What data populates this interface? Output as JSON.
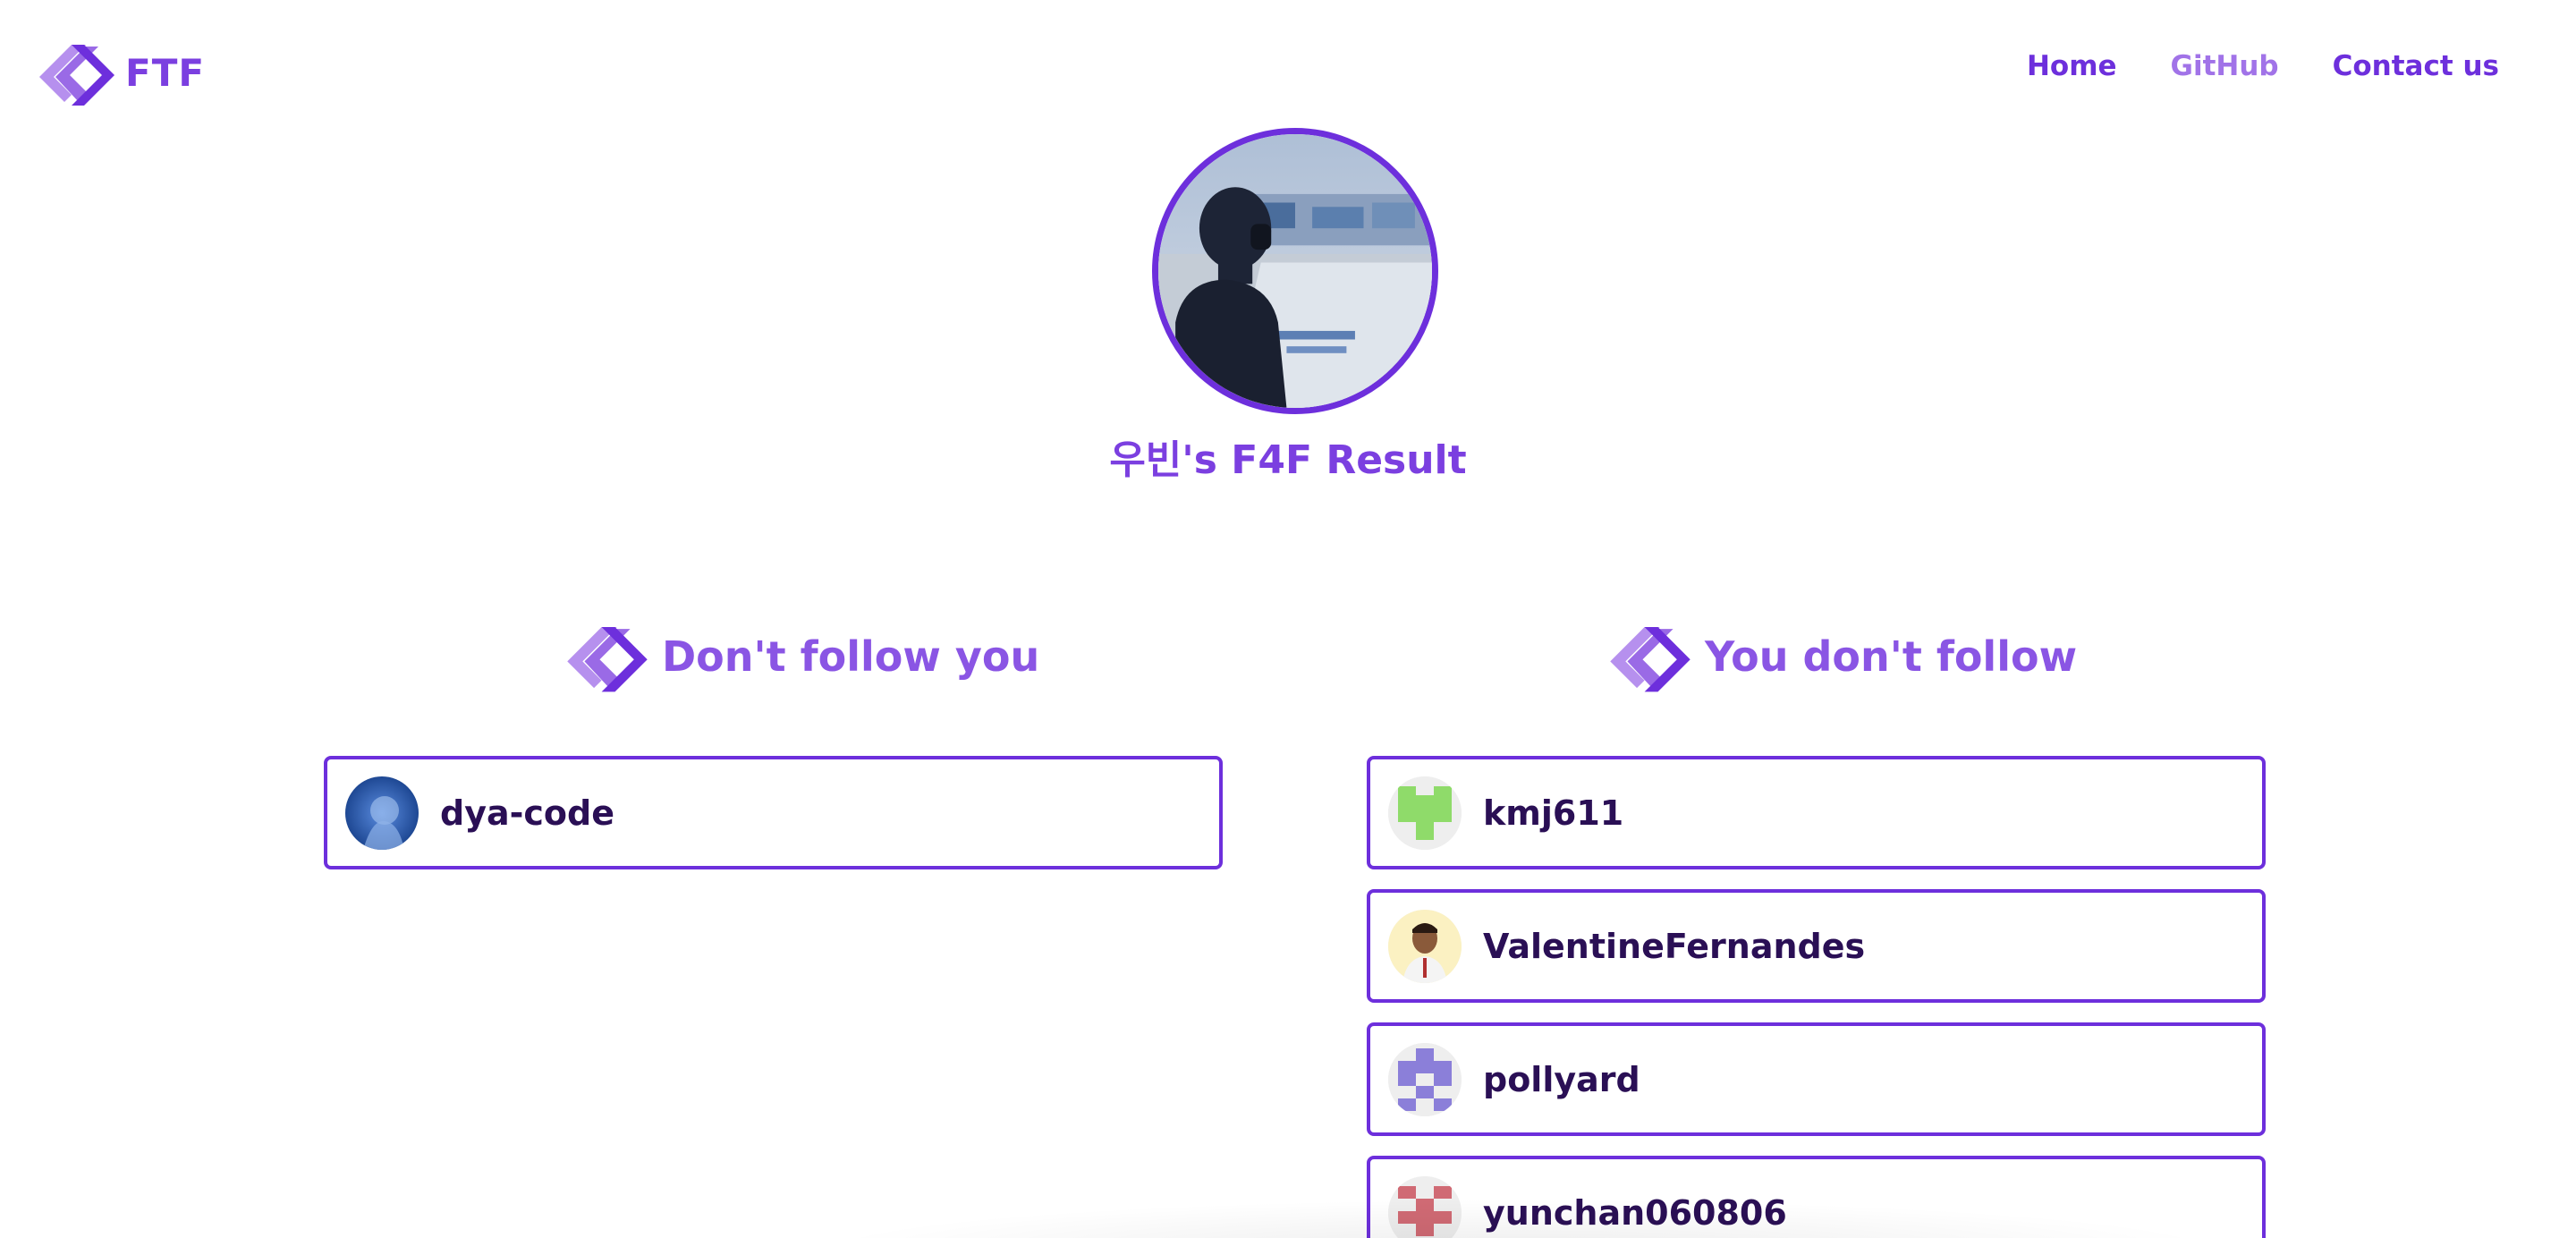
{
  "brand": {
    "text": "FTF",
    "colors": {
      "dark": "#6d2fdc",
      "light": "#b690ee",
      "ink": "#2a0f55",
      "border": "#6d2fdc"
    }
  },
  "nav": {
    "home": "Home",
    "github": "GitHub",
    "contact": "Contact us"
  },
  "profile": {
    "avatar_alt": "profile-photo",
    "title": "우빈's F4F Result"
  },
  "sections": {
    "left": {
      "title": "Don't follow you",
      "users": [
        {
          "name": "dya-code",
          "avatar": "blue-anime-avatar"
        }
      ]
    },
    "right": {
      "title": "You don't follow",
      "users": [
        {
          "name": "kmj611",
          "avatar": "green-identicon"
        },
        {
          "name": "ValentineFernandes",
          "avatar": "person-photo"
        },
        {
          "name": "pollyard",
          "avatar": "purple-identicon"
        },
        {
          "name": "yunchan060806",
          "avatar": "red-identicon"
        }
      ]
    }
  }
}
